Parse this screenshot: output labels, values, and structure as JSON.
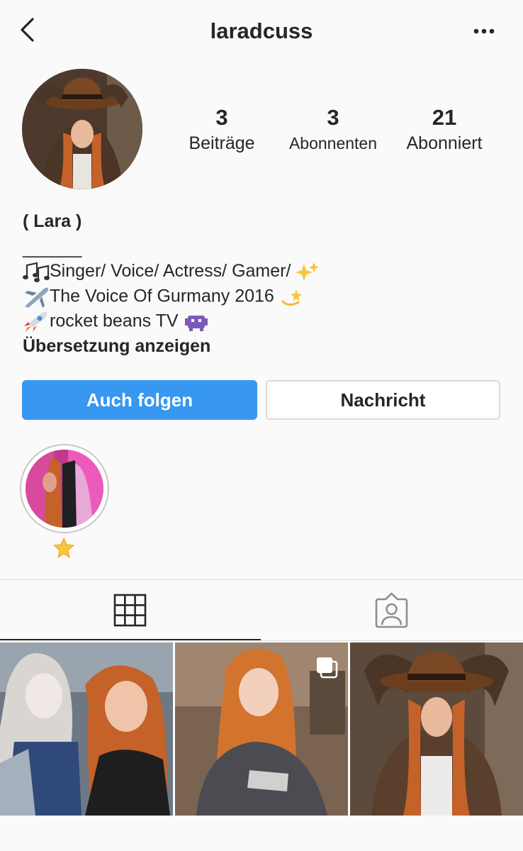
{
  "header": {
    "username": "laradcuss",
    "back_icon": "chevron-left-icon",
    "more_icon": "more-horizontal-icon"
  },
  "stats": {
    "posts": {
      "value": "3",
      "label": "Beiträge"
    },
    "followers": {
      "value": "3",
      "label": "Abonnenten"
    },
    "following": {
      "value": "21",
      "label": "Abonniert"
    }
  },
  "bio": {
    "name": "( Lara )",
    "lines": [
      "______",
      "Singer/ Voice/ Actress/ Gamer/",
      "The Voice Of Gurmany 2016",
      "rocket beans TV"
    ],
    "translate_label": "Übersetzung anzeigen"
  },
  "actions": {
    "follow_label": "Auch folgen",
    "message_label": "Nachricht"
  },
  "highlights": [
    {
      "label_icon": "glowing-star-icon"
    }
  ],
  "tabs": [
    {
      "icon": "grid-icon",
      "active": true
    },
    {
      "icon": "tagged-person-icon",
      "active": false
    }
  ],
  "colors": {
    "accent": "#3897f0",
    "text": "#262626",
    "background": "#fafafa",
    "divider": "#dbdbdb"
  }
}
